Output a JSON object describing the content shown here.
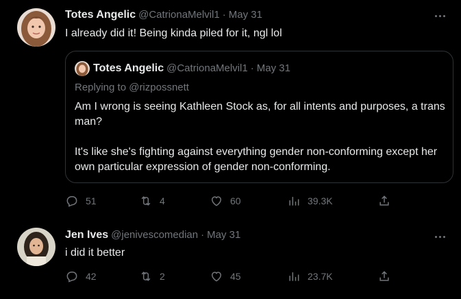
{
  "tweets": [
    {
      "name": "Totes Angelic",
      "handle": "@CatrionaMelvil1",
      "sep": "·",
      "date": "May 31",
      "text": "I already did it! Being kinda piled for it, ngl lol",
      "quote": {
        "name": "Totes Angelic",
        "handle": "@CatrionaMelvil1",
        "sep": "·",
        "date": "May 31",
        "replying": "Replying to @rizpossnett",
        "paragraph1": "Am I wrong is seeing Kathleen Stock as, for all intents and purposes, a trans man?",
        "paragraph2": "It's like she's fighting against everything gender non-conforming except her own particular expression of gender non-conforming."
      },
      "stats": {
        "replies": "51",
        "retweets": "4",
        "likes": "60",
        "views": "39.3K"
      }
    },
    {
      "name": "Jen Ives",
      "handle": "@jenivescomedian",
      "sep": "·",
      "date": "May 31",
      "text": "i did it better",
      "stats": {
        "replies": "42",
        "retweets": "2",
        "likes": "45",
        "views": "23.7K"
      }
    }
  ],
  "icons": {
    "reply": "reply-icon",
    "retweet": "retweet-icon",
    "like": "heart-icon",
    "views": "views-icon",
    "share": "share-icon",
    "more": "more-icon"
  },
  "colors": {
    "background": "#000000",
    "text": "#e7e9ea",
    "muted": "#71767b",
    "border": "#2f3336"
  }
}
